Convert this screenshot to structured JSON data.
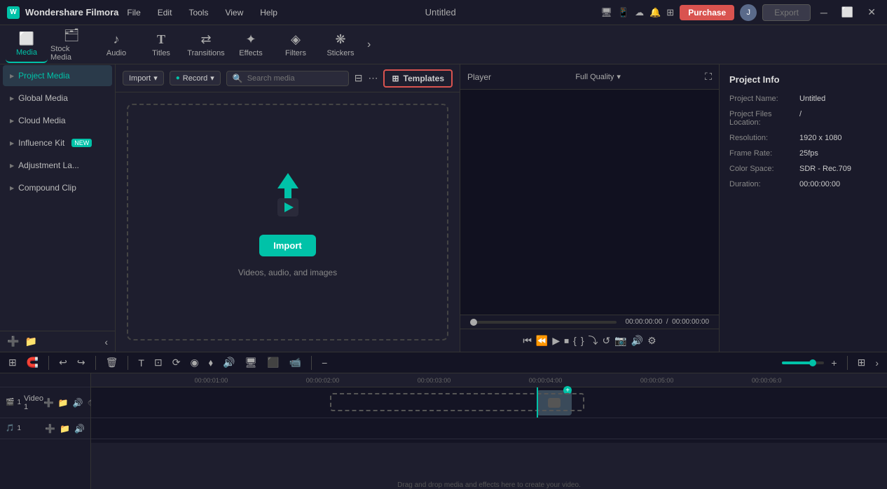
{
  "app": {
    "name": "Wondershare Filmora",
    "logo_letter": "W",
    "title": "Untitled"
  },
  "titlebar": {
    "menu_items": [
      "File",
      "Edit",
      "Tools",
      "View",
      "Help"
    ],
    "purchase_label": "Purchase",
    "export_label": "Export",
    "avatar_letter": "J"
  },
  "toolbar": {
    "items": [
      {
        "id": "media",
        "label": "Media",
        "icon": "🎬",
        "active": true
      },
      {
        "id": "stock",
        "label": "Stock Media",
        "icon": "📦"
      },
      {
        "id": "audio",
        "label": "Audio",
        "icon": "🎵"
      },
      {
        "id": "titles",
        "label": "Titles",
        "icon": "T"
      },
      {
        "id": "transitions",
        "label": "Transitions",
        "icon": "↔"
      },
      {
        "id": "effects",
        "label": "Effects",
        "icon": "✨"
      },
      {
        "id": "filters",
        "label": "Filters",
        "icon": "🔶"
      },
      {
        "id": "stickers",
        "label": "Stickers",
        "icon": "⭐"
      }
    ]
  },
  "sidebar": {
    "items": [
      {
        "id": "project-media",
        "label": "Project Media",
        "active": true
      },
      {
        "id": "global-media",
        "label": "Global Media"
      },
      {
        "id": "cloud-media",
        "label": "Cloud Media"
      },
      {
        "id": "influence-kit",
        "label": "Influence Kit",
        "badge": "NEW"
      },
      {
        "id": "adjustment-la",
        "label": "Adjustment La..."
      },
      {
        "id": "compound-clip",
        "label": "Compound Clip"
      }
    ]
  },
  "media": {
    "import_label": "Import",
    "record_label": "Record",
    "search_placeholder": "Search media",
    "templates_label": "Templates",
    "import_btn_label": "Import",
    "import_desc": "Videos, audio, and images"
  },
  "player": {
    "label": "Player",
    "quality": "Full Quality",
    "timecode": "00:00:00:00",
    "total_time": "00:00:00:00"
  },
  "project_info": {
    "title": "Project Info",
    "name_label": "Project Name:",
    "name_value": "Untitled",
    "files_label": "Project Files\nLocation:",
    "files_value": "/",
    "resolution_label": "Resolution:",
    "resolution_value": "1920 x 1080",
    "framerate_label": "Frame Rate:",
    "framerate_value": "25fps",
    "colorspace_label": "Color Space:",
    "colorspace_value": "SDR - Rec.709",
    "duration_label": "Duration:",
    "duration_value": "00:00:00:00"
  },
  "timeline": {
    "tracks": [
      {
        "id": "video-1",
        "label": "Video 1",
        "icon_count": "1"
      },
      {
        "id": "audio-1",
        "icon_count": "1"
      }
    ],
    "ruler_marks": [
      "00:00:01:00",
      "00:00:02:00",
      "00:00:03:00",
      "00:00:04:00",
      "00:00:05:00",
      "00:00:06:0"
    ],
    "drop_label": "Drag and drop media and effects here to create your video."
  }
}
